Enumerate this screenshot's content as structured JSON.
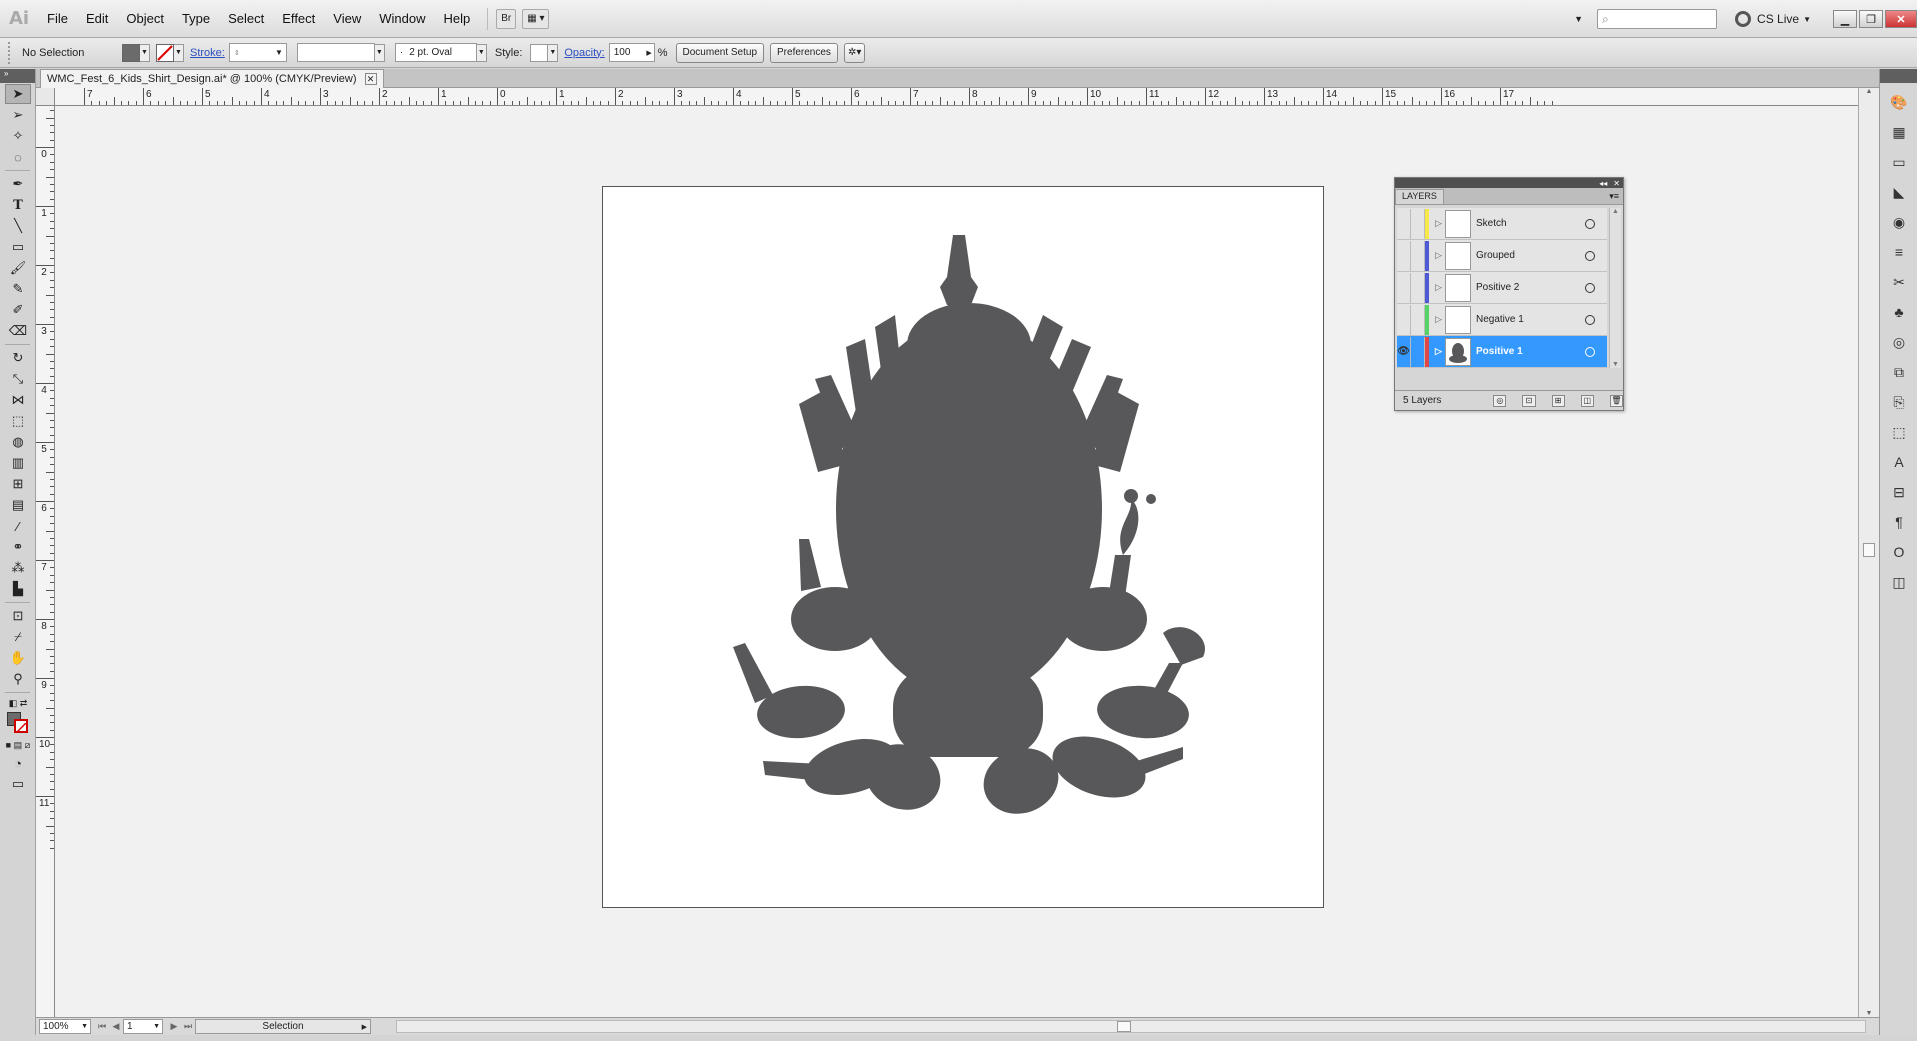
{
  "app": {
    "logo": "Ai"
  },
  "menu": [
    "File",
    "Edit",
    "Object",
    "Type",
    "Select",
    "Effect",
    "View",
    "Window",
    "Help"
  ],
  "menubar": {
    "bridge_label": "Br",
    "cs_live": "CS Live",
    "search_placeholder": ""
  },
  "control": {
    "selection_label": "No Selection",
    "fill_color": "#6b6b6b",
    "stroke_label": "Stroke:",
    "brush_value": "2 pt. Oval",
    "style_label": "Style:",
    "opacity_label": "Opacity:",
    "opacity_value": "100",
    "opacity_unit": "%",
    "document_setup": "Document Setup",
    "preferences": "Preferences"
  },
  "document": {
    "tab_title": "WMC_Fest_6_Kids_Shirt_Design.ai* @ 100% (CMYK/Preview)"
  },
  "ruler": {
    "h_labels": [
      "7",
      "6",
      "5",
      "4",
      "3",
      "2",
      "1",
      "0",
      "1",
      "2",
      "3",
      "4",
      "5",
      "6",
      "7",
      "8",
      "9",
      "10",
      "11",
      "12",
      "13",
      "14",
      "15",
      "16",
      "17"
    ],
    "v_labels": [
      "1",
      "0",
      "1",
      "2",
      "3",
      "4",
      "5",
      "6",
      "7",
      "8",
      "9",
      "10",
      "11"
    ]
  },
  "artwork": {
    "color": "#58585a"
  },
  "layers_panel": {
    "title": "LAYERS",
    "count_label": "5 Layers",
    "layers": [
      {
        "name": "Sketch",
        "color": "#f7e84a",
        "visible": false,
        "selected": false
      },
      {
        "name": "Grouped",
        "color": "#4f5bd5",
        "visible": false,
        "selected": false
      },
      {
        "name": "Positive 2",
        "color": "#4f5bd5",
        "visible": false,
        "selected": false
      },
      {
        "name": "Negative 1",
        "color": "#55d466",
        "visible": false,
        "selected": false
      },
      {
        "name": "Positive 1",
        "color": "#e04848",
        "visible": true,
        "selected": true
      }
    ]
  },
  "status": {
    "zoom": "100%",
    "page": "1",
    "tool": "Selection"
  }
}
